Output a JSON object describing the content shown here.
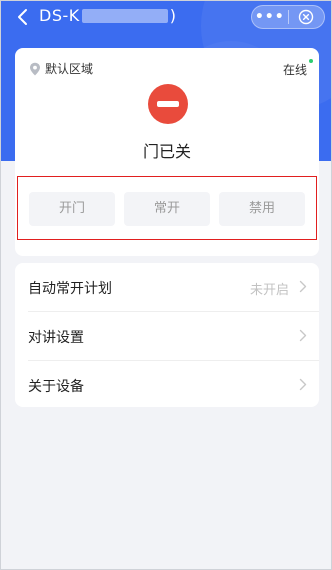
{
  "header": {
    "title_prefix": "DS-K",
    "title_suffix": ")",
    "more_label": "•••",
    "back_icon": "chevron-left-icon",
    "close_icon": "close-circle-icon",
    "background_color": "#3b6cf0"
  },
  "device": {
    "region_label": "默认区域",
    "region_icon": "location-pin-icon",
    "online_label": "在线",
    "online_color": "#2ecc71",
    "status_text": "门已关",
    "status_color": "#e94b3c"
  },
  "controls": {
    "open_label": "开门",
    "always_open_label": "常开",
    "disable_label": "禁用"
  },
  "settings": {
    "items": [
      {
        "label": "自动常开计划",
        "value": "未开启"
      },
      {
        "label": "对讲设置",
        "value": ""
      },
      {
        "label": "关于设备",
        "value": ""
      }
    ]
  }
}
